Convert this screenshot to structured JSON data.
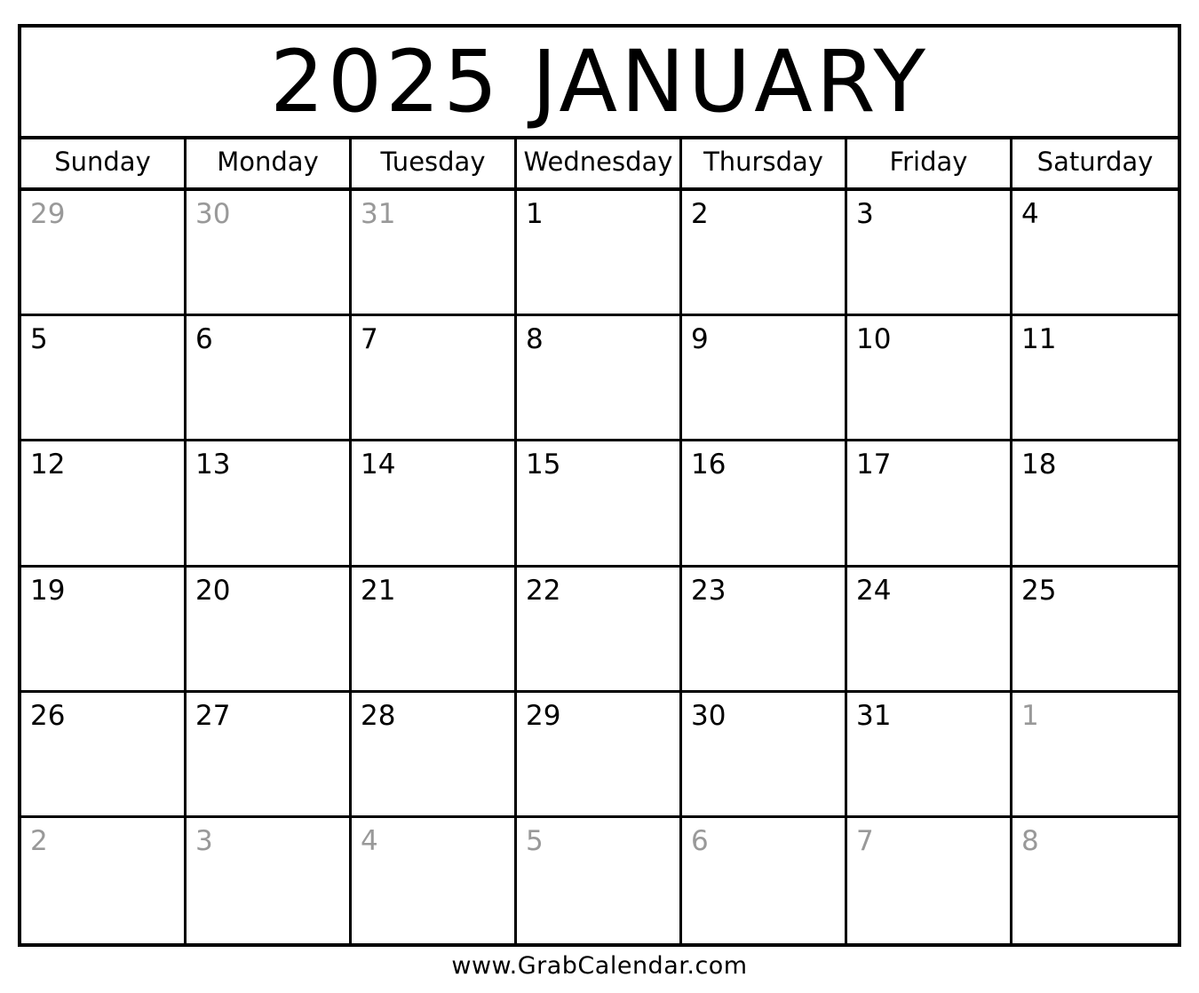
{
  "calendar": {
    "title": "2025 JANUARY",
    "weekdays": [
      "Sunday",
      "Monday",
      "Tuesday",
      "Wednesday",
      "Thursday",
      "Friday",
      "Saturday"
    ],
    "other_month_color": "#999999",
    "weeks": [
      [
        {
          "day": "29",
          "in_month": false
        },
        {
          "day": "30",
          "in_month": false
        },
        {
          "day": "31",
          "in_month": false
        },
        {
          "day": "1",
          "in_month": true
        },
        {
          "day": "2",
          "in_month": true
        },
        {
          "day": "3",
          "in_month": true
        },
        {
          "day": "4",
          "in_month": true
        }
      ],
      [
        {
          "day": "5",
          "in_month": true
        },
        {
          "day": "6",
          "in_month": true
        },
        {
          "day": "7",
          "in_month": true
        },
        {
          "day": "8",
          "in_month": true
        },
        {
          "day": "9",
          "in_month": true
        },
        {
          "day": "10",
          "in_month": true
        },
        {
          "day": "11",
          "in_month": true
        }
      ],
      [
        {
          "day": "12",
          "in_month": true
        },
        {
          "day": "13",
          "in_month": true
        },
        {
          "day": "14",
          "in_month": true
        },
        {
          "day": "15",
          "in_month": true
        },
        {
          "day": "16",
          "in_month": true
        },
        {
          "day": "17",
          "in_month": true
        },
        {
          "day": "18",
          "in_month": true
        }
      ],
      [
        {
          "day": "19",
          "in_month": true
        },
        {
          "day": "20",
          "in_month": true
        },
        {
          "day": "21",
          "in_month": true
        },
        {
          "day": "22",
          "in_month": true
        },
        {
          "day": "23",
          "in_month": true
        },
        {
          "day": "24",
          "in_month": true
        },
        {
          "day": "25",
          "in_month": true
        }
      ],
      [
        {
          "day": "26",
          "in_month": true
        },
        {
          "day": "27",
          "in_month": true
        },
        {
          "day": "28",
          "in_month": true
        },
        {
          "day": "29",
          "in_month": true
        },
        {
          "day": "30",
          "in_month": true
        },
        {
          "day": "31",
          "in_month": true
        },
        {
          "day": "1",
          "in_month": false
        }
      ],
      [
        {
          "day": "2",
          "in_month": false
        },
        {
          "day": "3",
          "in_month": false
        },
        {
          "day": "4",
          "in_month": false
        },
        {
          "day": "5",
          "in_month": false
        },
        {
          "day": "6",
          "in_month": false
        },
        {
          "day": "7",
          "in_month": false
        },
        {
          "day": "8",
          "in_month": false
        }
      ]
    ]
  },
  "footer": {
    "website": "www.GrabCalendar.com"
  }
}
